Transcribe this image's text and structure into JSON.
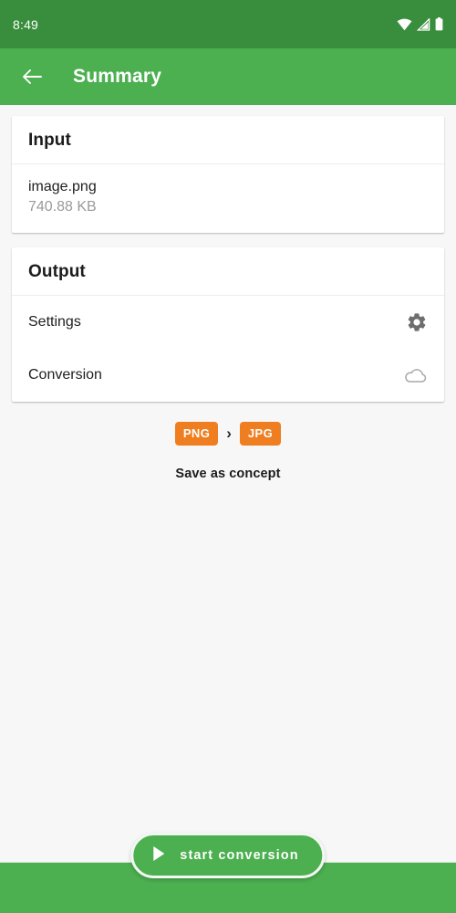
{
  "status_bar": {
    "time": "8:49",
    "icons": [
      "wifi-icon",
      "cellular-signal-icon",
      "battery-icon"
    ]
  },
  "app_bar": {
    "back_icon": "back-arrow-icon",
    "title": "Summary"
  },
  "input_card": {
    "header": "Input",
    "file_name": "image.png",
    "file_size": "740.88 KB"
  },
  "output_card": {
    "header": "Output",
    "rows": [
      {
        "label": "Settings",
        "icon": "gear-icon"
      },
      {
        "label": "Conversion",
        "icon": "cloud-icon"
      }
    ]
  },
  "format": {
    "source": "PNG",
    "arrow": "›",
    "target": "JPG"
  },
  "save_as_concept": "Save as concept",
  "start_conversion": {
    "label": "start conversion",
    "icon": "play-icon"
  },
  "colors": {
    "status_bar": "#388e3c",
    "app_bar": "#4caf50",
    "accent_badge": "#ee7e20",
    "page_background": "#f7f7f7",
    "card": "#ffffff",
    "gear_icon": "#6e6e6e",
    "cloud_icon": "#a8a8a8"
  }
}
